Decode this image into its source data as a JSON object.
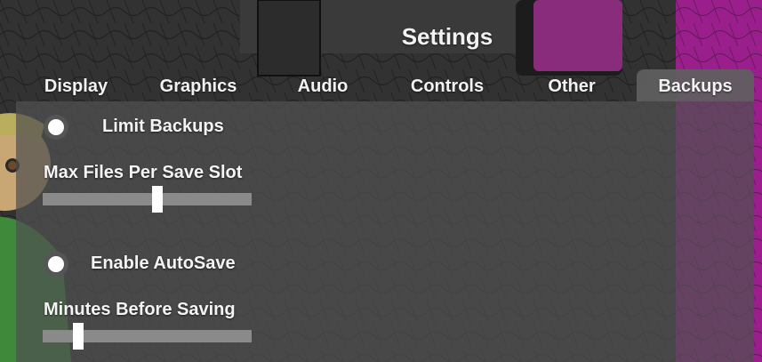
{
  "dialog": {
    "title": "Settings"
  },
  "tabs": [
    {
      "label": "Display",
      "active": false
    },
    {
      "label": "Graphics",
      "active": false
    },
    {
      "label": "Audio",
      "active": false
    },
    {
      "label": "Controls",
      "active": false
    },
    {
      "label": "Other",
      "active": false
    },
    {
      "label": "Backups",
      "active": true
    }
  ],
  "settings": {
    "limit_backups": {
      "label": "Limit Backups",
      "enabled": false
    },
    "max_files": {
      "label": "Max Files Per Save Slot",
      "value_fraction": 0.55
    },
    "enable_autosave": {
      "label": "Enable AutoSave",
      "enabled": false
    },
    "minutes_before_saving": {
      "label": "Minutes Before Saving",
      "value_fraction": 0.17
    }
  },
  "colors": {
    "panel": "#505050",
    "track": "#8a8a8a",
    "handle": "#ffffff",
    "magenta_accent": "#b0209f"
  }
}
